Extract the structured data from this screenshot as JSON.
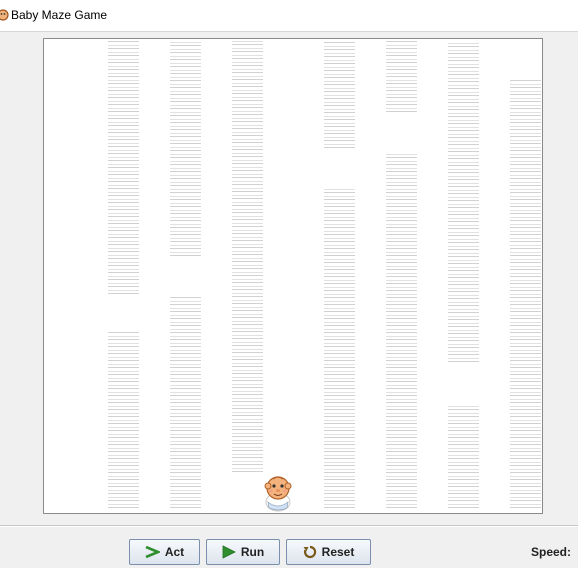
{
  "window": {
    "title": "Baby Maze Game"
  },
  "world": {
    "background": "#ffffff",
    "wall_columns": 7,
    "actor": "baby"
  },
  "controls": {
    "act_label": "Act",
    "run_label": "Run",
    "reset_label": "Reset",
    "speed_label": "Speed:",
    "accent_green": "#2f8f2f"
  }
}
